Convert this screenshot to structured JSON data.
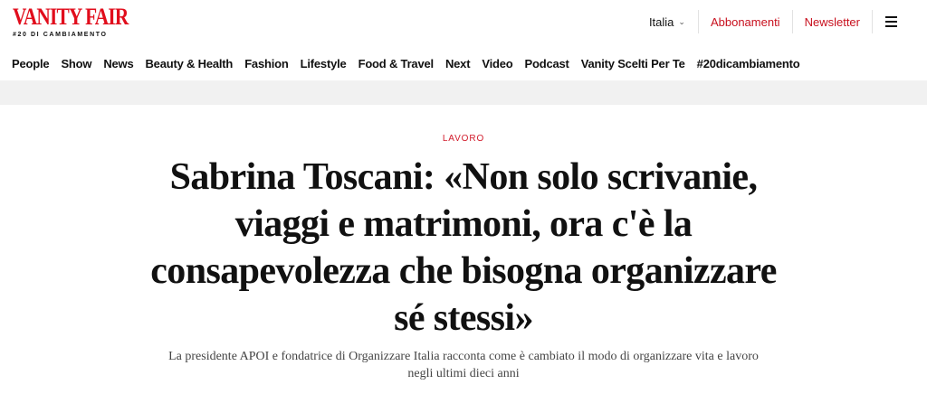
{
  "header": {
    "logo_text": "VANITY FAIR",
    "logo_subtitle": "#20 DI CAMBIAMENTO",
    "language": "Italia",
    "subscribe_label": "Abbonamenti",
    "newsletter_label": "Newsletter",
    "brand_color": "#e10d1c"
  },
  "nav": {
    "items": [
      "People",
      "Show",
      "News",
      "Beauty & Health",
      "Fashion",
      "Lifestyle",
      "Food & Travel",
      "Next",
      "Video",
      "Podcast",
      "Vanity Scelti Per Te",
      "#20dicambiamento"
    ]
  },
  "article": {
    "kicker": "LAVORO",
    "title": "Sabrina Toscani: «Non solo scrivanie, viaggi e matrimoni, ora c'è la consapevolezza che bisogna organizzare sé stessi»",
    "dek": "La presidente APOI e fondatrice di Organizzare Italia racconta come è cambiato il modo di organizzare vita e lavoro negli ultimi dieci anni"
  },
  "icons": {
    "language_chevron": "chevron-down-icon",
    "menu": "hamburger-menu-icon"
  }
}
